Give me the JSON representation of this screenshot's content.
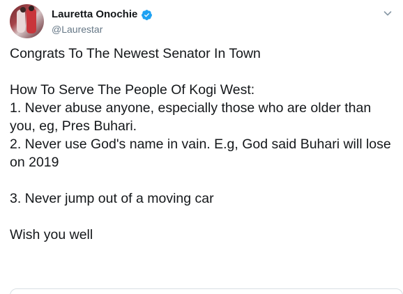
{
  "tweet": {
    "author": {
      "display_name": "Lauretta Onochie",
      "handle": "@Laurestar",
      "verified": true,
      "avatar_icon": "avatar-photo"
    },
    "menu_icon": "chevron-down-icon",
    "text": "Congrats To The Newest Senator In Town\n\nHow To Serve The People Of Kogi West:\n1. Never abuse anyone, especially those who are older than you, eg, Pres Buhari.\n2. Never use God's name in vain. E.g, God said Buhari will lose on 2019\n\n3. Never jump out of a moving car\n\nWish you well"
  },
  "colors": {
    "text": "#14171a",
    "secondary_text": "#657786",
    "verified_blue": "#1da1f2",
    "border": "#d8dfe4"
  }
}
